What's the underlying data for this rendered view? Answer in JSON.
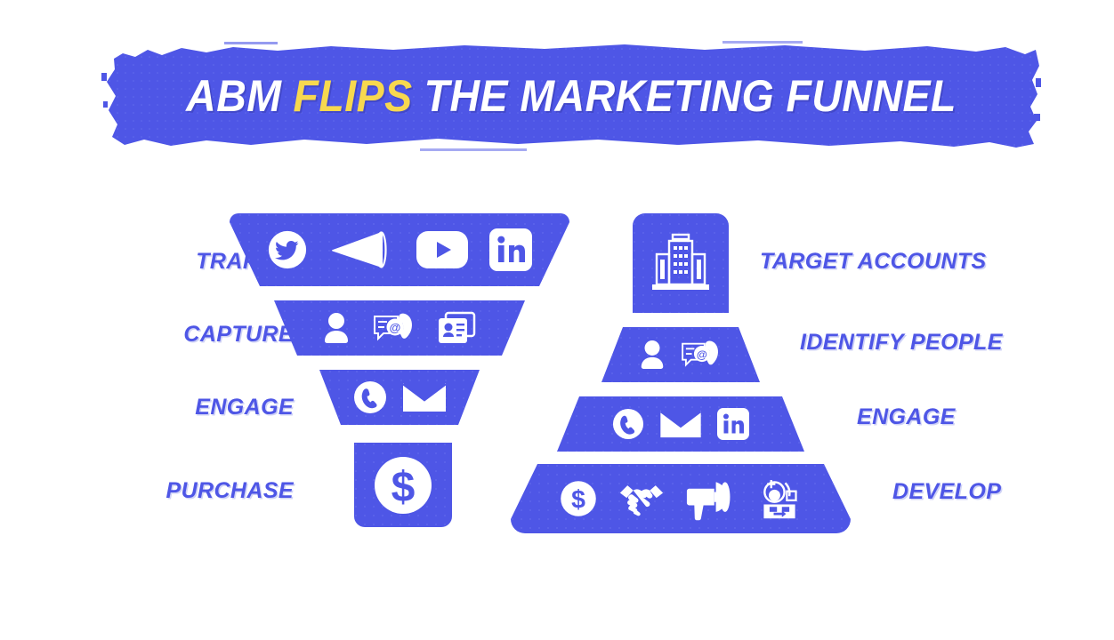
{
  "theme": {
    "brand_blue": "#4E56E6",
    "accent_yellow": "#F7D84F",
    "white": "#FFFFFF",
    "background": "#FFFFFF"
  },
  "header": {
    "title_full": "ABM FLIPS THE MARKETING FUNNEL",
    "part_1": "ABM",
    "part_accent": "FLIPS",
    "part_2": "THE MARKETING FUNNEL"
  },
  "diagram_data": {
    "type": "diagram",
    "title": "ABM FLIPS THE MARKETING FUNNEL",
    "left_diagram": {
      "name": "Traditional marketing funnel",
      "shape": "inverted-funnel",
      "label_side": "left",
      "stages": [
        {
          "label": "TRAFFIC",
          "width_rank": 1,
          "icons": [
            "twitter-icon",
            "megaphone-icon",
            "youtube-icon",
            "linkedin-icon"
          ]
        },
        {
          "label": "CAPTURE",
          "width_rank": 2,
          "icons": [
            "person-icon",
            "contact-chat-phone-icon",
            "contact-card-icon"
          ]
        },
        {
          "label": "ENGAGE",
          "width_rank": 3,
          "icons": [
            "phone-circle-icon",
            "envelope-icon"
          ]
        },
        {
          "label": "PURCHASE",
          "width_rank": 4,
          "icons": [
            "dollar-circle-icon"
          ]
        }
      ]
    },
    "right_diagram": {
      "name": "Account based marketing pyramid",
      "shape": "pyramid",
      "label_side": "right",
      "stages": [
        {
          "label": "TARGET ACCOUNTS",
          "width_rank": 4,
          "icons": [
            "office-building-icon"
          ]
        },
        {
          "label": "IDENTIFY PEOPLE",
          "width_rank": 3,
          "icons": [
            "person-icon",
            "contact-chat-phone-icon"
          ]
        },
        {
          "label": "ENGAGE",
          "width_rank": 2,
          "icons": [
            "phone-circle-icon",
            "envelope-icon",
            "linkedin-icon"
          ]
        },
        {
          "label": "DEVELOP",
          "width_rank": 1,
          "icons": [
            "dollar-circle-icon",
            "handshake-icon",
            "megaphone-icon",
            "account-expansion-icon"
          ]
        }
      ]
    }
  }
}
